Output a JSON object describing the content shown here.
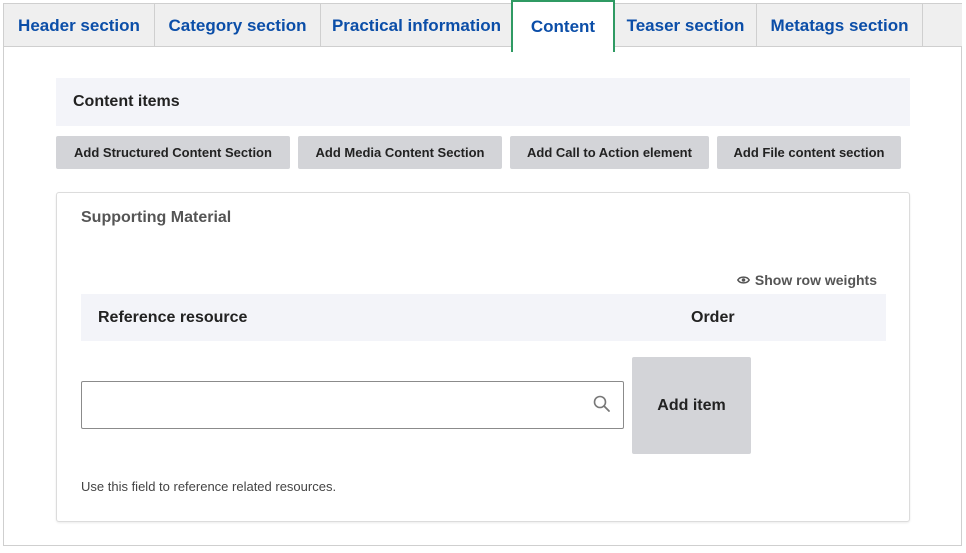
{
  "tabs": [
    {
      "label": "Header section"
    },
    {
      "label": "Category section"
    },
    {
      "label": "Practical information"
    },
    {
      "label": "Content"
    },
    {
      "label": "Teaser section"
    },
    {
      "label": "Metatags section"
    }
  ],
  "active_tab": "Content",
  "content_items": {
    "title": "Content items",
    "buttons": [
      {
        "label": "Add Structured Content Section"
      },
      {
        "label": "Add Media Content Section"
      },
      {
        "label": "Add Call to Action element"
      },
      {
        "label": "Add File content section"
      }
    ]
  },
  "supporting_material": {
    "title": "Supporting Material",
    "show_row_weights": "Show row weights",
    "columns": {
      "reference": "Reference resource",
      "order": "Order"
    },
    "reference_input_value": "",
    "add_item_label": "Add item",
    "help_text": "Use this field to reference related resources."
  },
  "colors": {
    "tab_text": "#0b4ea8",
    "active_tab_border": "#2f9a63",
    "button_bg": "#d3d4d8",
    "header_bg": "#f3f4f9"
  }
}
